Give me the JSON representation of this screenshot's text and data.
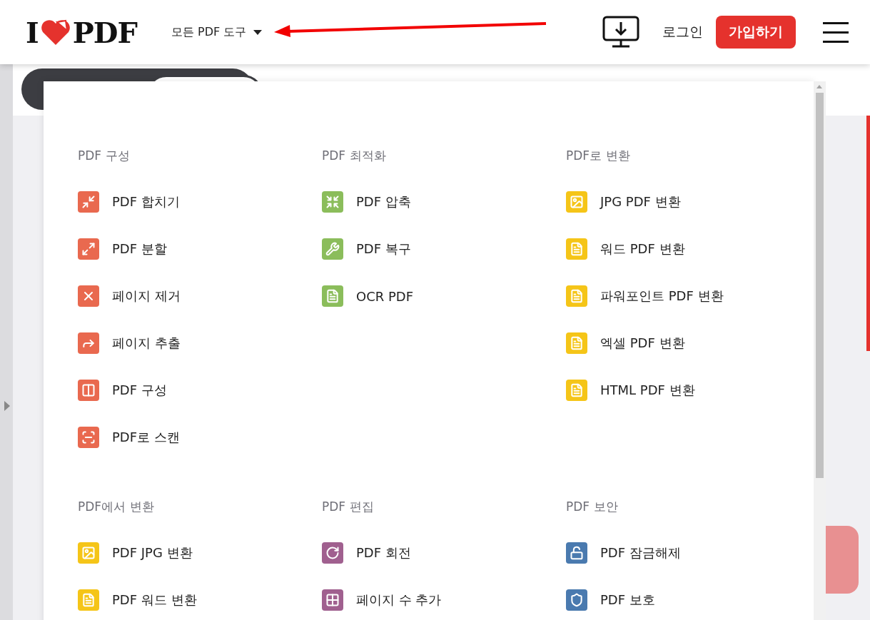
{
  "header": {
    "logo": {
      "left": "I",
      "right": "PDF"
    },
    "tools_menu": {
      "label": "모든 PDF 도구",
      "expanded": true
    },
    "login": "로그인",
    "signup": "가입하기"
  },
  "tools_panel": {
    "sections": [
      {
        "title": "PDF 구성",
        "color": "#e9694f",
        "items": [
          "PDF 합치기",
          "PDF 분할",
          "페이지 제거",
          "페이지 추출",
          "PDF 구성",
          "PDF로 스캔"
        ]
      },
      {
        "title": "PDF 최적화",
        "color": "#8bbd5b",
        "items": [
          "PDF 압축",
          "PDF 복구",
          "OCR PDF"
        ]
      },
      {
        "title": "PDF로 변환",
        "color": "#f5c518",
        "items": [
          "JPG PDF 변환",
          "워드 PDF 변환",
          "파워포인트 PDF 변환",
          "엑셀 PDF 변환",
          "HTML PDF 변환"
        ]
      },
      {
        "title": "PDF에서 변환",
        "color": "#f5c518",
        "items": [
          "PDF JPG 변환",
          "PDF 워드 변환"
        ]
      },
      {
        "title": "PDF 편집",
        "color": "#a0608f",
        "items": [
          "PDF 회전",
          "페이지 수 추가"
        ]
      },
      {
        "title": "PDF 보안",
        "color": "#4a7aaf",
        "items": [
          "PDF 잠금해제",
          "PDF 보호"
        ]
      }
    ]
  }
}
